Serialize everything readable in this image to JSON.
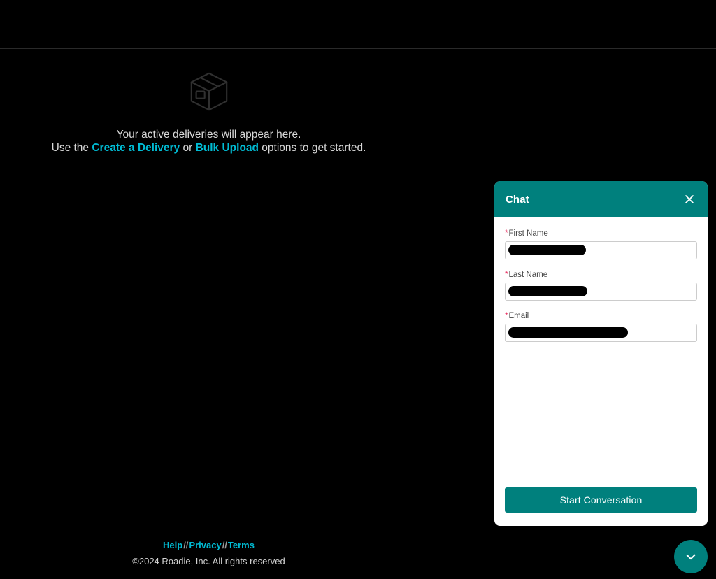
{
  "header": {
    "title": ""
  },
  "empty_state": {
    "icon": "package-box-icon",
    "line1": "Your active deliveries will appear here.",
    "line2_prefix": "Use the ",
    "link_create": "Create a Delivery",
    "line2_mid": " or ",
    "link_bulk": "Bulk Upload",
    "line2_suffix": " options to get started."
  },
  "footer": {
    "help_label": "Help",
    "sep1": "//",
    "privacy_label": "Privacy",
    "sep2": "//",
    "terms_label": "Terms",
    "copyright": "©2024 Roadie, Inc. All rights reserved"
  },
  "chat": {
    "title": "Chat",
    "close_icon": "close-icon",
    "fields": [
      {
        "required_mark": "*",
        "label": "First Name",
        "value": "",
        "redacted": true
      },
      {
        "required_mark": "*",
        "label": "Last Name",
        "value": "",
        "redacted": true
      },
      {
        "required_mark": "*",
        "label": "Email",
        "value": "",
        "redacted": true
      }
    ],
    "submit_label": "Start Conversation",
    "launcher_icon": "chevron-down-icon"
  },
  "colors": {
    "page_background": "#000000",
    "accent_link": "#00bcd4",
    "chat_teal": "#00807d",
    "required_red": "#e8275a",
    "panel_background": "#ffffff",
    "divider": "#2a2a2a"
  }
}
